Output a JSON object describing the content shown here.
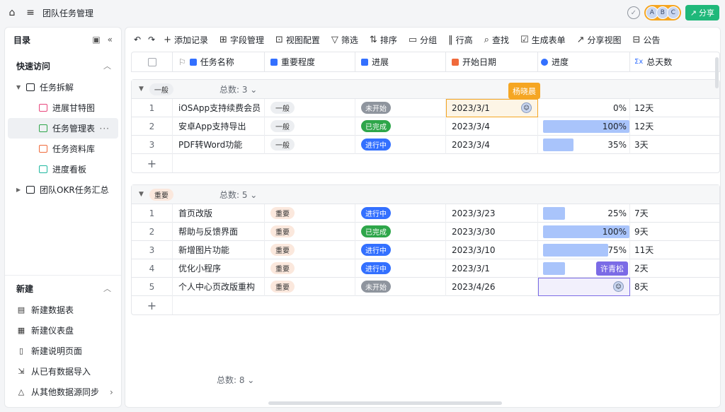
{
  "topbar": {
    "title": "团队任务管理",
    "share_label": "分享",
    "avatars": [
      "A",
      "B",
      "C"
    ]
  },
  "sidebar": {
    "header": "目录",
    "quick_label": "快速访问",
    "tree": [
      {
        "label": "任务拆解",
        "icon": "table-icon"
      },
      {
        "label": "进展甘特图",
        "icon": "gantt-icon",
        "color": "#e8467c"
      },
      {
        "label": "任务管理表",
        "icon": "grid-icon",
        "color": "#2ea64a",
        "more": "···"
      },
      {
        "label": "任务资料库",
        "icon": "gallery-icon",
        "color": "#f06a3b"
      },
      {
        "label": "进度看板",
        "icon": "kanban-icon",
        "color": "#1fb8a0"
      },
      {
        "label": "团队OKR任务汇总",
        "icon": "table-icon"
      }
    ],
    "new_label": "新建",
    "new_items": [
      {
        "label": "新建数据表",
        "icon": "table-icon"
      },
      {
        "label": "新建仪表盘",
        "icon": "dashboard-icon"
      },
      {
        "label": "新建说明页面",
        "icon": "doc-icon"
      },
      {
        "label": "从已有数据导入",
        "icon": "import-icon"
      },
      {
        "label": "从其他数据源同步",
        "icon": "sync-icon",
        "arrow": "›"
      }
    ]
  },
  "toolbar": {
    "undo": "↶",
    "redo": "↷",
    "items": [
      {
        "label": "添加记录",
        "glyph": "+"
      },
      {
        "label": "字段管理",
        "glyph": "⊞"
      },
      {
        "label": "视图配置",
        "glyph": "⊡"
      },
      {
        "label": "筛选",
        "glyph": "▽"
      },
      {
        "label": "排序",
        "glyph": "⇅"
      },
      {
        "label": "分组",
        "glyph": "▭"
      },
      {
        "label": "行高",
        "glyph": "‖"
      },
      {
        "label": "查找",
        "glyph": "⌕"
      },
      {
        "label": "生成表单",
        "glyph": "☑"
      },
      {
        "label": "分享视图",
        "glyph": "↗"
      },
      {
        "label": "公告",
        "glyph": "⊟"
      }
    ]
  },
  "columns": {
    "name": "任务名称",
    "importance": "重要程度",
    "status": "进展",
    "start": "开始日期",
    "progress": "进度",
    "days": "总天数",
    "name_color": "#3370ff",
    "importance_color": "#3370ff",
    "status_color": "#3370ff",
    "start_color": "#f06a3b",
    "progress_color": "#3370ff"
  },
  "groups": [
    {
      "tag": "一般",
      "count": "总数: 3 ⌄",
      "rows": [
        {
          "idx": "1",
          "name": "iOSApp支持续费会员",
          "importance": "一般",
          "status": "未开始",
          "status_type": "ns",
          "start": "2023/3/1",
          "progress": 0,
          "progress_text": "0%",
          "days": "12天"
        },
        {
          "idx": "2",
          "name": "安卓App支持导出",
          "importance": "一般",
          "status": "已完成",
          "status_type": "done",
          "start": "2023/3/4",
          "progress": 100,
          "progress_text": "100%",
          "days": "12天"
        },
        {
          "idx": "3",
          "name": "PDF转Word功能",
          "importance": "一般",
          "status": "进行中",
          "status_type": "ing",
          "start": "2023/3/4",
          "progress": 35,
          "progress_text": "35%",
          "days": "3天"
        }
      ]
    },
    {
      "tag": "重要",
      "count": "总数: 5 ⌄",
      "rows": [
        {
          "idx": "1",
          "name": "首页改版",
          "importance": "重要",
          "status": "进行中",
          "status_type": "ing",
          "start": "2023/3/23",
          "progress": 25,
          "progress_text": "25%",
          "days": "7天"
        },
        {
          "idx": "2",
          "name": "帮助与反馈界面",
          "importance": "重要",
          "status": "已完成",
          "status_type": "done",
          "start": "2023/3/30",
          "progress": 100,
          "progress_text": "100%",
          "days": "9天"
        },
        {
          "idx": "3",
          "name": "新增图片功能",
          "importance": "重要",
          "status": "进行中",
          "status_type": "ing",
          "start": "2023/3/10",
          "progress": 75,
          "progress_text": "75%",
          "days": "11天"
        },
        {
          "idx": "4",
          "name": "优化小程序",
          "importance": "重要",
          "status": "进行中",
          "status_type": "ing",
          "start": "2023/3/1",
          "progress": 25,
          "progress_text": "",
          "days": "2天"
        },
        {
          "idx": "5",
          "name": "个人中心页改版重构",
          "importance": "重要",
          "status": "未开始",
          "status_type": "ns",
          "start": "2023/4/26",
          "progress": 0,
          "progress_text": "",
          "days": "8天"
        }
      ]
    }
  ],
  "collab": [
    {
      "name": "杨晓晨",
      "color": "#f5a623"
    },
    {
      "name": "许青松",
      "color": "#7b6be6"
    }
  ],
  "footer": {
    "total": "总数: 8 ⌄"
  },
  "add_glyph": "+"
}
